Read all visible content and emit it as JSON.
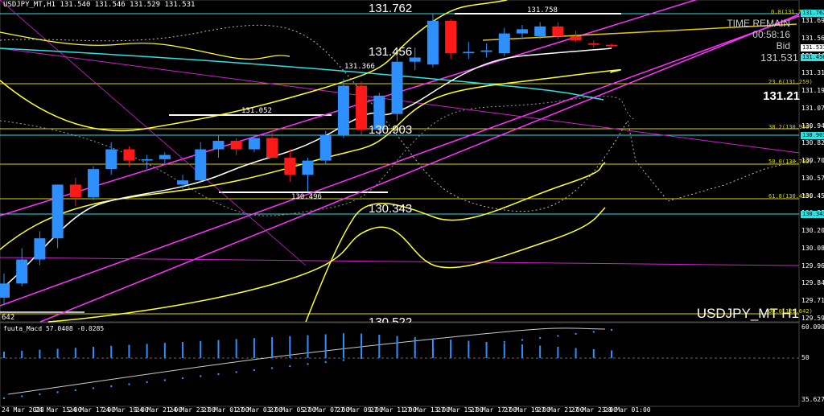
{
  "header": {
    "symbol_line": "USDJPY_MT,H1  131.540 131.546 131.529 131.531"
  },
  "price_labels": {
    "high": "131.762",
    "p131456": "131.456",
    "p131366": "131.366",
    "p131052": "131.052",
    "p130903": "130.903",
    "p130496": "130.496",
    "p130343": "130.343",
    "p130522": "130.522",
    "p131758": "131.758",
    "left_cut": "642"
  },
  "info_panel": {
    "time_remain_label": "TIME REMAIN",
    "time_remain_value": "00:58:16",
    "bid_label": "Bid",
    "bid_value": "131.531",
    "current_price": "131.21",
    "watermark": "USDJPY_MT H1"
  },
  "fibo_levels": {
    "f0": "0.0(131.758)",
    "f236": "23.6(131.259)",
    "f382": "38.2(130.950)",
    "f50": "50.0(130.700)",
    "f618": "61.8(130.450)",
    "f100": "00.0(129.642)"
  },
  "price_axis": {
    "tags": {
      "t131762": "131.762",
      "t131531": "131.531",
      "t131456": "131.456",
      "t130903": "130.903",
      "t130343": "130.343"
    },
    "ticks": [
      "131.690",
      "131.565",
      "131.440",
      "131.315",
      "131.190",
      "131.070",
      "130.945",
      "130.825",
      "130.700",
      "130.575",
      "130.450",
      "130.330",
      "130.205",
      "130.085",
      "129.965",
      "129.840",
      "129.715",
      "129.590"
    ]
  },
  "indicator": {
    "label": "fuuta_Macd 57.0408  -0.0285",
    "top_value": "60.0909",
    "mid_value": "50",
    "bottom_value": "35.6279"
  },
  "time_axis": {
    "labels": [
      "24 Mar 2023",
      "24 Mar 15:00",
      "24 Mar 17:00",
      "24 Mar 19:00",
      "24 Mar 21:00",
      "24 Mar 23:00",
      "27 Mar 01:00",
      "27 Mar 03:00",
      "27 Mar 05:00",
      "27 Mar 07:00",
      "27 Mar 09:00",
      "27 Mar 11:00",
      "27 Mar 13:00",
      "27 Mar 15:00",
      "27 Mar 17:00",
      "27 Mar 19:00",
      "27 Mar 21:00",
      "27 Mar 23:00",
      "28 Mar 01:00"
    ]
  },
  "colors": {
    "bull": "#2e8fff",
    "bear": "#ff1a1a",
    "magenta": "#ff33ff",
    "yellow": "#ffff33",
    "cyan": "#33e0e0"
  },
  "chart_data": {
    "type": "candlestick",
    "candles": [
      {
        "o": 129.75,
        "h": 129.92,
        "l": 129.7,
        "c": 129.85
      },
      {
        "o": 129.85,
        "h": 130.1,
        "l": 129.83,
        "c": 130.02
      },
      {
        "o": 130.02,
        "h": 130.22,
        "l": 129.98,
        "c": 130.17
      },
      {
        "o": 130.17,
        "h": 130.55,
        "l": 130.1,
        "c": 130.55
      },
      {
        "o": 130.55,
        "h": 130.6,
        "l": 130.4,
        "c": 130.46
      },
      {
        "o": 130.46,
        "h": 130.68,
        "l": 130.44,
        "c": 130.66
      },
      {
        "o": 130.66,
        "h": 130.85,
        "l": 130.62,
        "c": 130.8
      },
      {
        "o": 130.8,
        "h": 130.82,
        "l": 130.68,
        "c": 130.72
      },
      {
        "o": 130.72,
        "h": 130.76,
        "l": 130.66,
        "c": 130.73
      },
      {
        "o": 130.73,
        "h": 130.78,
        "l": 130.7,
        "c": 130.76
      },
      {
        "o": 130.55,
        "h": 130.62,
        "l": 130.52,
        "c": 130.58
      },
      {
        "o": 130.58,
        "h": 130.85,
        "l": 130.56,
        "c": 130.8
      },
      {
        "o": 130.8,
        "h": 130.9,
        "l": 130.74,
        "c": 130.86
      },
      {
        "o": 130.86,
        "h": 130.88,
        "l": 130.76,
        "c": 130.8
      },
      {
        "o": 130.8,
        "h": 130.9,
        "l": 130.78,
        "c": 130.88
      },
      {
        "o": 130.88,
        "h": 130.92,
        "l": 130.8,
        "c": 130.74
      },
      {
        "o": 130.74,
        "h": 130.8,
        "l": 130.57,
        "c": 130.62
      },
      {
        "o": 130.62,
        "h": 130.74,
        "l": 130.5,
        "c": 130.72
      },
      {
        "o": 130.72,
        "h": 130.93,
        "l": 130.7,
        "c": 130.9
      },
      {
        "o": 130.9,
        "h": 131.3,
        "l": 130.88,
        "c": 131.25
      },
      {
        "o": 131.25,
        "h": 131.28,
        "l": 130.9,
        "c": 130.94
      },
      {
        "o": 130.94,
        "h": 131.2,
        "l": 130.9,
        "c": 131.18
      },
      {
        "o": 131.05,
        "h": 131.46,
        "l": 131.0,
        "c": 131.42
      },
      {
        "o": 131.42,
        "h": 131.52,
        "l": 131.36,
        "c": 131.45
      },
      {
        "o": 131.4,
        "h": 131.76,
        "l": 131.38,
        "c": 131.71
      },
      {
        "o": 131.71,
        "h": 131.72,
        "l": 131.44,
        "c": 131.48
      },
      {
        "o": 131.48,
        "h": 131.56,
        "l": 131.44,
        "c": 131.49
      },
      {
        "o": 131.49,
        "h": 131.55,
        "l": 131.45,
        "c": 131.5
      },
      {
        "o": 131.48,
        "h": 131.66,
        "l": 131.46,
        "c": 131.62
      },
      {
        "o": 131.62,
        "h": 131.68,
        "l": 131.58,
        "c": 131.65
      },
      {
        "o": 131.6,
        "h": 131.7,
        "l": 131.58,
        "c": 131.67
      },
      {
        "o": 131.67,
        "h": 131.7,
        "l": 131.58,
        "c": 131.6
      },
      {
        "o": 131.6,
        "h": 131.64,
        "l": 131.56,
        "c": 131.57
      },
      {
        "o": 131.55,
        "h": 131.57,
        "l": 131.52,
        "c": 131.54
      },
      {
        "o": 131.54,
        "h": 131.55,
        "l": 131.52,
        "c": 131.53
      }
    ],
    "ylim": [
      129.59,
      131.8
    ]
  }
}
